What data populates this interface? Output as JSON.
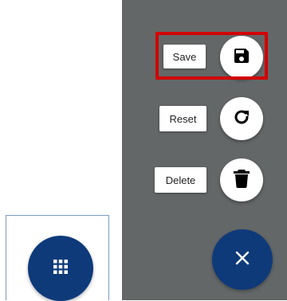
{
  "launcher": {
    "icon": "apps-grid-icon",
    "color": "#0e3a7a"
  },
  "speed_dial": {
    "background": "#646768",
    "actions": [
      {
        "label": "Save",
        "icon": "save-icon"
      },
      {
        "label": "Reset",
        "icon": "reset-icon"
      },
      {
        "label": "Delete",
        "icon": "delete-icon"
      }
    ],
    "highlighted_action": "Save",
    "highlight_color": "#d30000",
    "close_icon": "close-icon",
    "close_color": "#0e3a7a"
  }
}
